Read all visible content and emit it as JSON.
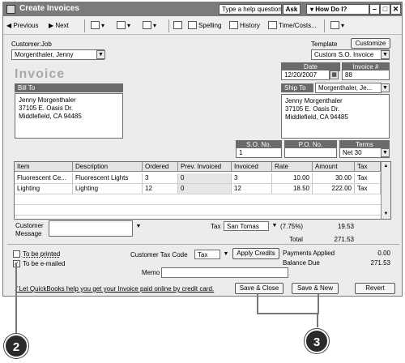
{
  "window": {
    "title": "Create Invoices",
    "help_placeholder": "Type a help question",
    "ask_label": "Ask",
    "howdoi_label": "How Do I?",
    "minimize": "–",
    "maximize": "□",
    "close": "✕"
  },
  "toolbar": {
    "previous": "Previous",
    "next": "Next",
    "spelling": "Spelling",
    "history": "History",
    "time_costs": "Time/Costs..."
  },
  "form": {
    "customer_job_label": "Customer:Job",
    "customer_job_value": "Morgenthaler, Jenny",
    "template_label": "Template",
    "customize_label": "Customize",
    "template_value": "Custom S.O. Invoice",
    "invoice_title": "Invoice",
    "date_label": "Date",
    "date_value": "12/20/2007",
    "invoice_no_label": "Invoice #",
    "invoice_no_value": "88",
    "bill_to_label": "Bill To",
    "bill_to_lines": [
      "Jenny Morgenthaler",
      "37105 E. Oasis Dr.",
      "Middlefield, CA 94485"
    ],
    "ship_to_label": "Ship To",
    "ship_to_select": "Morgenthaler, Je...",
    "ship_to_lines": [
      "Jenny Morgenthaler",
      "37105 E. Oasis Dr.",
      "Middlefield, CA 94485"
    ],
    "so_no_label": "S.O. No.",
    "so_no_value": "1",
    "po_no_label": "P.O. No.",
    "po_no_value": "",
    "terms_label": "Terms",
    "terms_value": "Net 30"
  },
  "table": {
    "headers": [
      "Item",
      "Description",
      "Ordered",
      "Prev. Invoiced",
      "Invoiced",
      "Rate",
      "Amount",
      "Tax"
    ],
    "rows": [
      [
        "Fluorescent Ce...",
        "Fluorescent Lights",
        "3",
        "0",
        "3",
        "10.00",
        "30.00",
        "Tax"
      ],
      [
        "Lighting",
        "Lighting",
        "12",
        "0",
        "12",
        "18.50",
        "222.00",
        "Tax"
      ]
    ]
  },
  "footer": {
    "customer_message_label": "Customer Message",
    "tax_label": "Tax",
    "tax_value": "San Tomas",
    "tax_rate": "(7.75%)",
    "tax_amount": "19.53",
    "total_label": "Total",
    "total_value": "271.53",
    "to_be_printed": "To be printed",
    "to_be_emailed": "To be e-mailed",
    "customer_tax_code_label": "Customer Tax Code",
    "customer_tax_code_value": "Tax",
    "apply_credits": "Apply Credits",
    "payments_applied_label": "Payments Applied",
    "payments_applied_value": "0.00",
    "balance_due_label": "Balance Due",
    "balance_due_value": "271.53",
    "memo_label": "Memo",
    "online_pay_text": "Let QuickBooks help you get your Invoice paid online by credit card.",
    "save_close": "Save & Close",
    "save_new": "Save & New",
    "revert": "Revert"
  },
  "callouts": [
    "2",
    "3"
  ]
}
